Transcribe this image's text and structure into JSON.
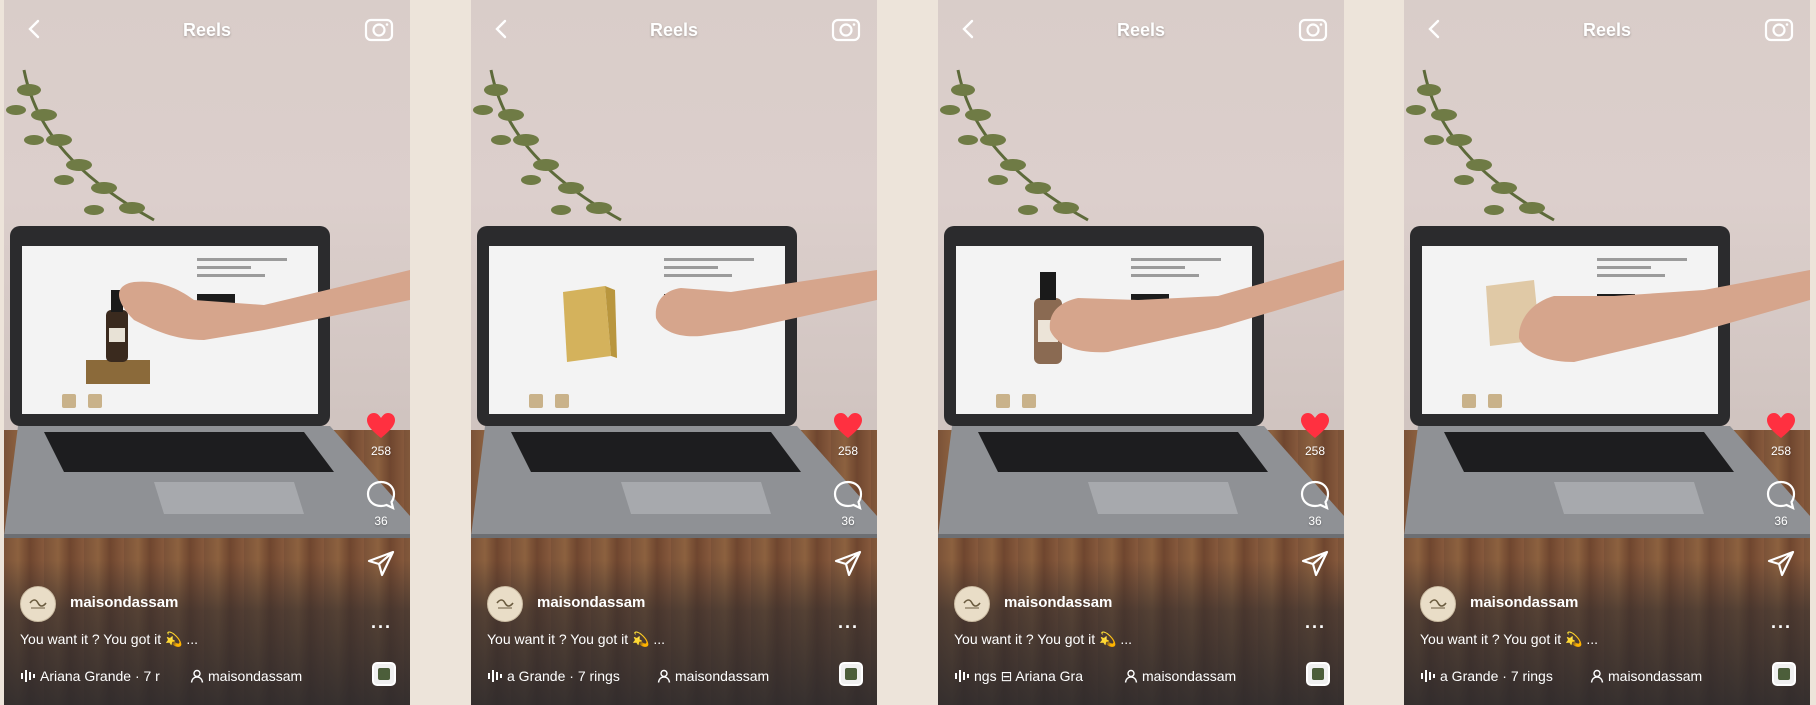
{
  "colors": {
    "like": "#ff3040",
    "background": "#ede4da",
    "text": "#ffffff"
  },
  "icons": [
    "back-chevron-icon",
    "camera-icon",
    "heart-icon",
    "comment-icon",
    "send-icon",
    "more-icon",
    "person-icon",
    "music-eq-icon"
  ],
  "screens": [
    {
      "title": "Reels",
      "likes": "258",
      "comments": "36",
      "more": "...",
      "username": "maisondassam",
      "caption": "You want it ? You got it 💫 ...",
      "music": "Ariana Grande · 7 r",
      "tag": "maisondassam"
    },
    {
      "title": "Reels",
      "likes": "258",
      "comments": "36",
      "more": "...",
      "username": "maisondassam",
      "caption": "You want it ? You got it 💫 ...",
      "music": "a Grande · 7 rings",
      "tag": "maisondassam"
    },
    {
      "title": "Reels",
      "likes": "258",
      "comments": "36",
      "more": "...",
      "username": "maisondassam",
      "caption": "You want it ? You got it 💫 ...",
      "music": "ngs ⊟ Ariana Gra",
      "tag": "maisondassam"
    },
    {
      "title": "Reels",
      "likes": "258",
      "comments": "36",
      "more": "...",
      "username": "maisondassam",
      "caption": "You want it ? You got it 💫 ...",
      "music": "a Grande · 7 rings",
      "tag": "maisondassam"
    }
  ]
}
